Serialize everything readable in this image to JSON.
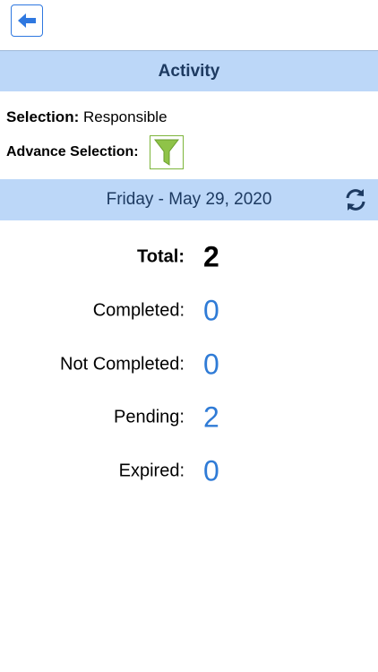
{
  "header": {
    "back_icon": "arrow-left-icon",
    "title": "Activity"
  },
  "selection": {
    "label": "Selection:",
    "value": "Responsible"
  },
  "advance_selection": {
    "label": "Advance Selection:",
    "icon": "filter-icon"
  },
  "date_bar": {
    "date": "Friday - May 29, 2020",
    "refresh_icon": "refresh-icon"
  },
  "stats": [
    {
      "label": "Total:",
      "value": "2"
    },
    {
      "label": "Completed:",
      "value": "0"
    },
    {
      "label": "Not Completed:",
      "value": "0"
    },
    {
      "label": "Pending:",
      "value": "2"
    },
    {
      "label": "Expired:",
      "value": "0"
    }
  ],
  "colors": {
    "accent": "#2f7bd6",
    "bar": "#bcd7f8",
    "title_text": "#1d3a61",
    "filter": "#7db53b"
  }
}
